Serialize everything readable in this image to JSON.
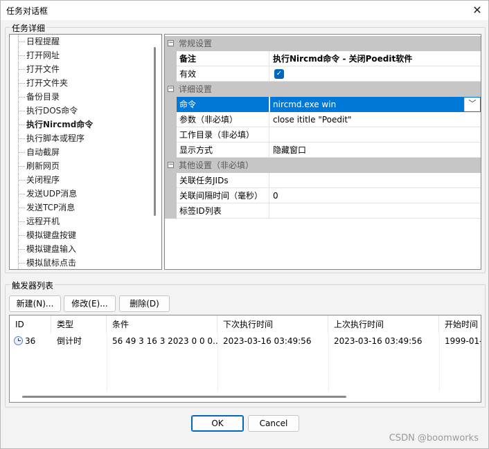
{
  "window": {
    "title": "任务对话框",
    "close_glyph": "✕"
  },
  "task_detail": {
    "group_label": "任务详细",
    "items": [
      "日程提醒",
      "打开网址",
      "打开文件",
      "打开文件夹",
      "备份目录",
      "执行DOS命令",
      "执行Nircmd命令",
      "执行脚本或程序",
      "自动截屏",
      "刷新网页",
      "关闭程序",
      "发送UDP消息",
      "发送TCP消息",
      "远程开机",
      "模拟键盘按键",
      "模拟键盘输入",
      "模拟鼠标点击"
    ],
    "selected_index": 6
  },
  "properties": {
    "categories": [
      {
        "label": "常规设置",
        "toggle": "−"
      },
      {
        "label": "详细设置",
        "toggle": "−"
      },
      {
        "label": "其他设置（非必填）",
        "toggle": "−"
      }
    ],
    "rows": [
      {
        "name": "备注",
        "value": "执行Nircmd命令 - 关闭Poedit软件"
      },
      {
        "name": "有效",
        "value": "",
        "checked": true
      },
      {
        "name": "命令",
        "value": "nircmd.exe win"
      },
      {
        "name": "参数（非必填）",
        "value": "close ititle \"Poedit\""
      },
      {
        "name": "工作目录（非必填）",
        "value": ""
      },
      {
        "name": "显示方式",
        "value": "隐藏窗口"
      },
      {
        "name": "关联任务JIDs",
        "value": ""
      },
      {
        "name": "关联间隔时间（毫秒）",
        "value": "0"
      },
      {
        "name": "标签ID列表",
        "value": ""
      }
    ]
  },
  "triggers": {
    "group_label": "触发器列表",
    "buttons": {
      "new": "新建(N)...",
      "edit": "修改(E)...",
      "delete": "删除(D)"
    },
    "columns": [
      "ID",
      "类型",
      "条件",
      "下次执行时间",
      "上次执行时间",
      "开始时间"
    ],
    "rows": [
      {
        "id": "36",
        "type": "倒计时",
        "condition": "56 49 3 16 3 2023 0 0 0...",
        "next": "2023-03-16 03:49:56",
        "last": "2023-03-16 03:49:56",
        "start": "1999-01-"
      }
    ]
  },
  "footer": {
    "ok": "OK",
    "cancel": "Cancel"
  },
  "watermark": "CSDN @boomworks",
  "colors": {
    "accent": "#0078d7",
    "category_bg": "#c6c6c6"
  }
}
